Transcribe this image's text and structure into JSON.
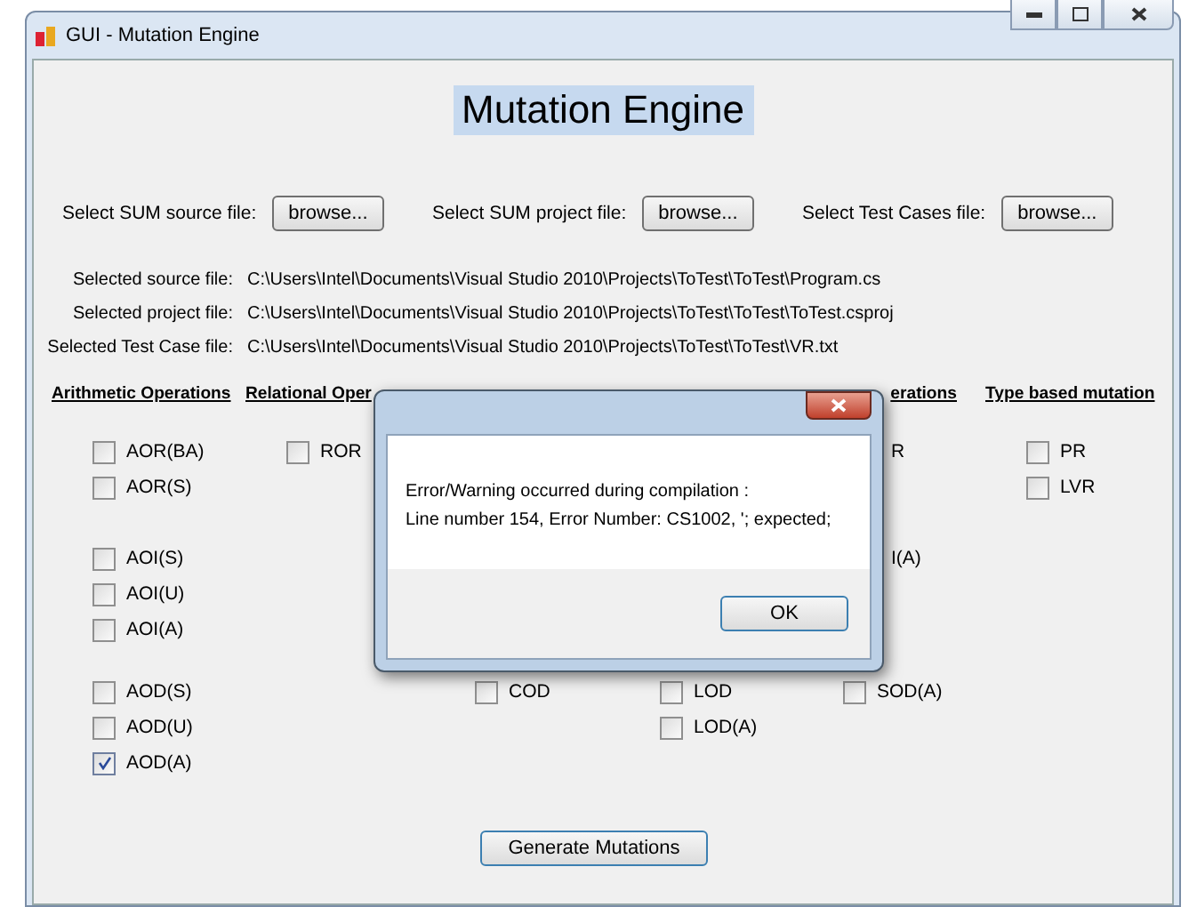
{
  "window": {
    "title": "GUI - Mutation Engine"
  },
  "heading": "Mutation Engine",
  "file_pickers": [
    {
      "label": "Select SUM source file:",
      "button": "browse..."
    },
    {
      "label": "Select SUM project file:",
      "button": "browse..."
    },
    {
      "label": "Select Test Cases file:",
      "button": "browse..."
    }
  ],
  "selected_files": [
    {
      "label": "Selected source file:",
      "path": "C:\\Users\\Intel\\Documents\\Visual Studio 2010\\Projects\\ToTest\\ToTest\\Program.cs"
    },
    {
      "label": "Selected project file:",
      "path": "C:\\Users\\Intel\\Documents\\Visual Studio 2010\\Projects\\ToTest\\ToTest\\ToTest.csproj"
    },
    {
      "label": "Selected Test Case file:",
      "path": "C:\\Users\\Intel\\Documents\\Visual Studio 2010\\Projects\\ToTest\\ToTest\\VR.txt"
    }
  ],
  "columns": [
    {
      "header": "Arithmetic Operations",
      "group_1": [
        {
          "kind": "checkbox",
          "label": "AOR(BA)",
          "checked": false
        },
        {
          "kind": "checkbox",
          "label": "AOR(S)",
          "checked": false
        }
      ],
      "group_2": [
        {
          "kind": "checkbox",
          "label": "AOI(S)",
          "checked": false
        },
        {
          "kind": "checkbox",
          "label": "AOI(U)",
          "checked": false
        },
        {
          "kind": "checkbox",
          "label": "AOI(A)",
          "checked": false
        }
      ],
      "group_3": [
        {
          "kind": "checkbox",
          "label": "AOD(S)",
          "checked": false
        },
        {
          "kind": "checkbox",
          "label": "AOD(U)",
          "checked": false
        },
        {
          "kind": "checkbox",
          "label": "AOD(A)",
          "checked": true
        }
      ]
    },
    {
      "header": "Relational Oper",
      "group_1": [
        {
          "kind": "checkbox",
          "label": "ROR",
          "checked": false
        }
      ]
    },
    {
      "group_3": [
        {
          "kind": "checkbox",
          "label": "COD",
          "checked": false
        }
      ]
    },
    {
      "group_3": [
        {
          "kind": "checkbox",
          "label": "LOD",
          "checked": false
        },
        {
          "kind": "checkbox",
          "label": "LOD(A)",
          "checked": false
        }
      ]
    },
    {
      "header": "erations",
      "group_1": [
        {
          "kind": "fragment",
          "label": "R"
        }
      ],
      "group_2": [
        {
          "kind": "fragment",
          "label": "I(A)"
        }
      ],
      "group_3": [
        {
          "kind": "checkbox",
          "label": "SOD(A)",
          "checked": false
        }
      ]
    },
    {
      "header": "Type based mutation",
      "group_1": [
        {
          "kind": "checkbox",
          "label": "PR",
          "checked": false
        },
        {
          "kind": "checkbox",
          "label": "LVR",
          "checked": false
        }
      ]
    }
  ],
  "generate_button": "Generate Mutations",
  "dialog": {
    "message": "Error/Warning occurred during compilation :\nLine number 154, Error Number: CS1002, '; expected;",
    "button": "OK"
  }
}
